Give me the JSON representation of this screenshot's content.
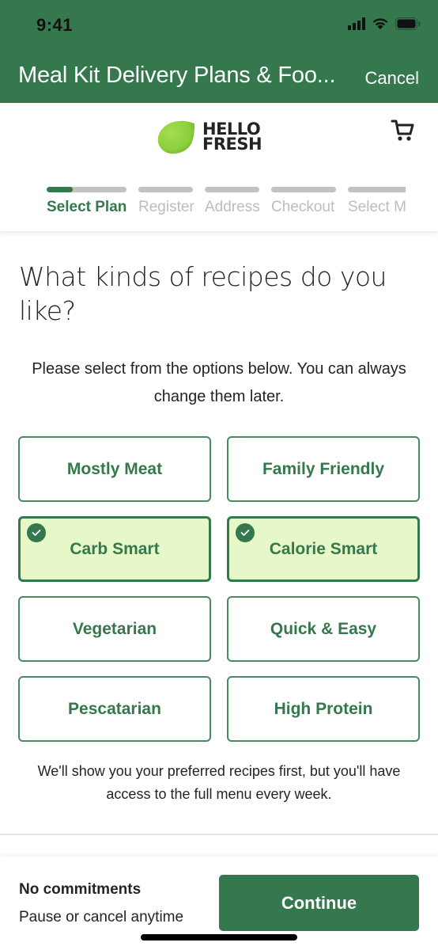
{
  "status_bar": {
    "time": "9:41"
  },
  "nav": {
    "title": "Meal Kit Delivery Plans & Foo...",
    "cancel_label": "Cancel"
  },
  "header": {
    "logo_line1": "HELLO",
    "logo_line2": "FRESH",
    "cart_icon": "cart-icon"
  },
  "stepper": {
    "steps": [
      {
        "label": "Select Plan",
        "active": true,
        "progress": 0.33
      },
      {
        "label": "Register",
        "active": false,
        "progress": 0
      },
      {
        "label": "Address",
        "active": false,
        "progress": 0
      },
      {
        "label": "Checkout",
        "active": false,
        "progress": 0
      },
      {
        "label": "Select M",
        "active": false,
        "progress": 0
      }
    ]
  },
  "main": {
    "question": "What kinds of recipes do you like?",
    "subtitle": "Please select from the options below. You can always change them later.",
    "options": [
      {
        "label": "Mostly Meat",
        "selected": false
      },
      {
        "label": "Family Friendly",
        "selected": false
      },
      {
        "label": "Carb Smart",
        "selected": true
      },
      {
        "label": "Calorie Smart",
        "selected": true
      },
      {
        "label": "Vegetarian",
        "selected": false
      },
      {
        "label": "Quick & Easy",
        "selected": false
      },
      {
        "label": "Pescatarian",
        "selected": false
      },
      {
        "label": "High Protein",
        "selected": false
      }
    ],
    "footnote": "We'll show you your preferred recipes first, but you'll have access to the full menu every week."
  },
  "bottom_bar": {
    "commit_title": "No commitments",
    "commit_sub": "Pause or cancel anytime",
    "continue_label": "Continue"
  },
  "colors": {
    "brand_green": "#35784d",
    "selected_bg": "#e6f8c8",
    "inactive_step": "#c2c2c2",
    "lime": "#8dcf3f"
  }
}
